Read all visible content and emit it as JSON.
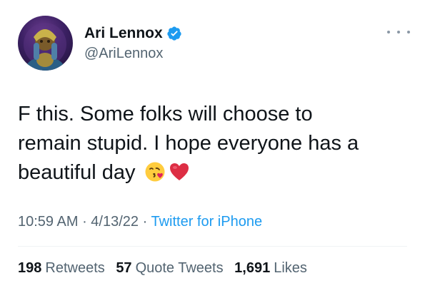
{
  "user": {
    "display_name": "Ari Lennox",
    "handle": "@AriLennox",
    "verified_icon": "verified-badge-icon",
    "avatar_icon": "profile-avatar"
  },
  "menu": {
    "icon": "more-options-icon"
  },
  "tweet": {
    "lines": [
      "F this. Some folks will choose to",
      "remain stupid. I hope everyone has a",
      "beautiful day"
    ],
    "emojis": [
      "kissing-face-emoji",
      "red-heart-emoji"
    ]
  },
  "meta": {
    "time": "10:59 AM",
    "sep1": " · ",
    "date": "4/13/22",
    "sep2": " · ",
    "source": "Twitter for iPhone"
  },
  "stats": {
    "retweets_count": "198",
    "retweets_label": "Retweets",
    "quotes_count": "57",
    "quotes_label": "Quote Tweets",
    "likes_count": "1,691",
    "likes_label": "Likes"
  },
  "colors": {
    "accent": "#1d9bf0",
    "text": "#0f1419",
    "secondary": "#536471"
  }
}
